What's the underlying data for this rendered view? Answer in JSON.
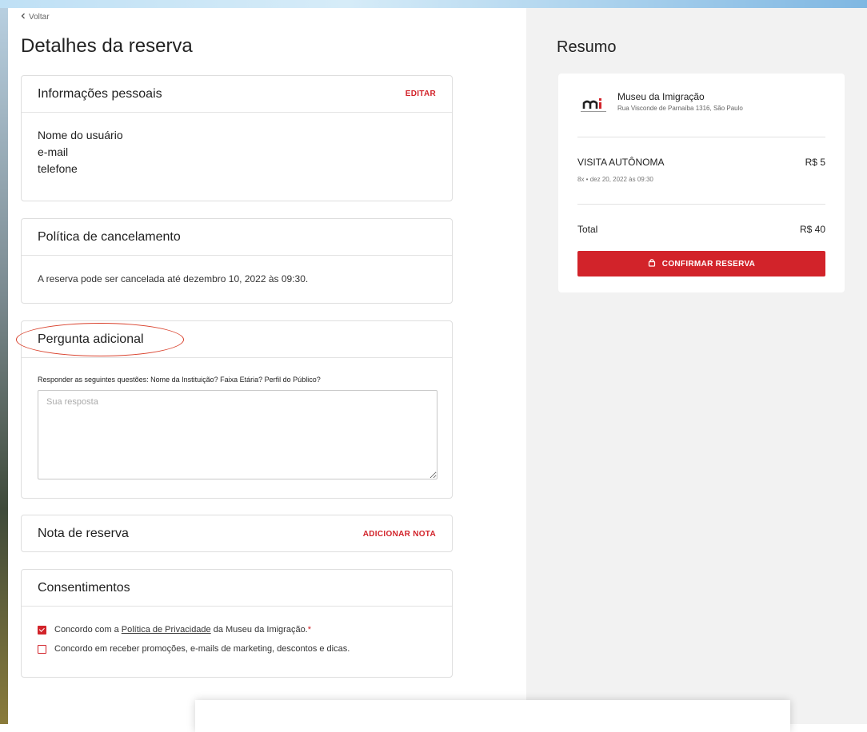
{
  "nav": {
    "back_label": "Voltar"
  },
  "page": {
    "title": "Detalhes da reserva"
  },
  "personal": {
    "title": "Informações pessoais",
    "edit_label": "EDITAR",
    "name": "Nome do usuário",
    "email": "e-mail",
    "phone": "telefone"
  },
  "cancellation": {
    "title": "Política de cancelamento",
    "text": "A reserva pode ser cancelada até dezembro 10, 2022 às 09:30."
  },
  "question": {
    "title": "Pergunta adicional",
    "label": "Responder as seguintes questões: Nome da Instituição? Faixa Etária? Perfil do Público?",
    "placeholder": "Sua resposta"
  },
  "note": {
    "title": "Nota de reserva",
    "add_label": "ADICIONAR NOTA"
  },
  "consents": {
    "title": "Consentimentos",
    "privacy_prefix": "Concordo com a ",
    "privacy_link": "Política de Privacidade",
    "privacy_suffix": " da Museu da Imigração.",
    "privacy_required": "*",
    "privacy_checked": true,
    "marketing": "Concordo em receber promoções, e-mails de marketing, descontos e dicas.",
    "marketing_checked": false
  },
  "summary": {
    "title": "Resumo",
    "museum_name": "Museu da Imigração",
    "museum_address": "Rua Visconde de Parnaíba 1316, São Paulo",
    "item_name": "VISITA AUTÔNOMA",
    "item_price": "R$ 5",
    "item_detail": "8x  •  dez 20, 2022 às 09:30",
    "total_label": "Total",
    "total_value": "R$ 40",
    "confirm_label": "CONFIRMAR RESERVA"
  },
  "colors": {
    "accent": "#d2232a",
    "annotation": "#d9412c",
    "right_bg": "#f2f2f2"
  },
  "icons": {
    "back": "chevron-left-icon",
    "lock": "lock-icon",
    "logo": "museum-logo-icon"
  }
}
